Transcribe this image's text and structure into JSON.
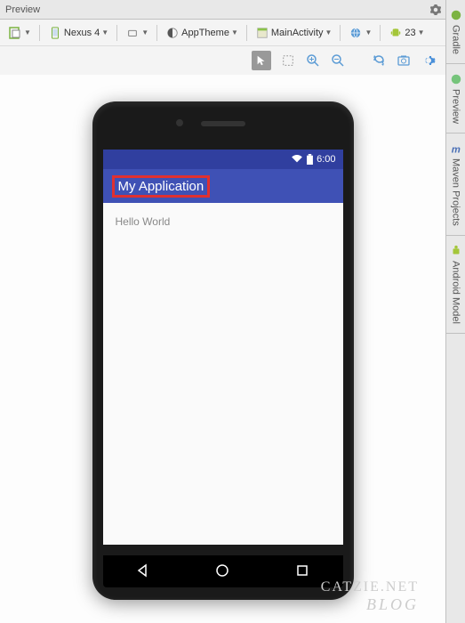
{
  "panel": {
    "title": "Preview"
  },
  "toolbar": {
    "device": "Nexus 4",
    "theme": "AppTheme",
    "activity": "MainActivity",
    "api_level": "23"
  },
  "side_tabs": {
    "gradle": "Gradle",
    "preview": "Preview",
    "maven": "Maven Projects",
    "android_model": "Android Model"
  },
  "app": {
    "status_time": "6:00",
    "title": "My Application",
    "body_text": "Hello World"
  },
  "watermark": {
    "line1": "CATZIE.NET",
    "line2": "BLOG"
  }
}
